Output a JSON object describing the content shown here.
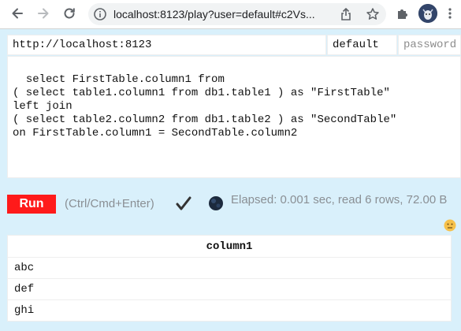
{
  "browser": {
    "url": "localhost:8123/play?user=default#c2Vs..."
  },
  "connection": {
    "server_url": "http://localhost:8123",
    "user": "default",
    "password_placeholder": "password"
  },
  "query": {
    "text": "select FirstTable.column1 from\n( select table1.column1 from db1.table1 ) as \"FirstTable\"\nleft join\n( select table2.column2 from db1.table2 ) as \"SecondTable\"\non FirstTable.column1 = SecondTable.column2"
  },
  "toolbar": {
    "run_label": "Run",
    "shortcut_hint": "(Ctrl/Cmd+Enter)",
    "status_check": "✔",
    "elapsed_text": "Elapsed: 0.001 sec, read 6 rows, 72.00 B"
  },
  "results": {
    "header": "column1",
    "rows": [
      "abc",
      "def",
      "ghi"
    ]
  },
  "colors": {
    "page_bg": "#d9f0fb",
    "run_button": "#ff1a1a"
  }
}
